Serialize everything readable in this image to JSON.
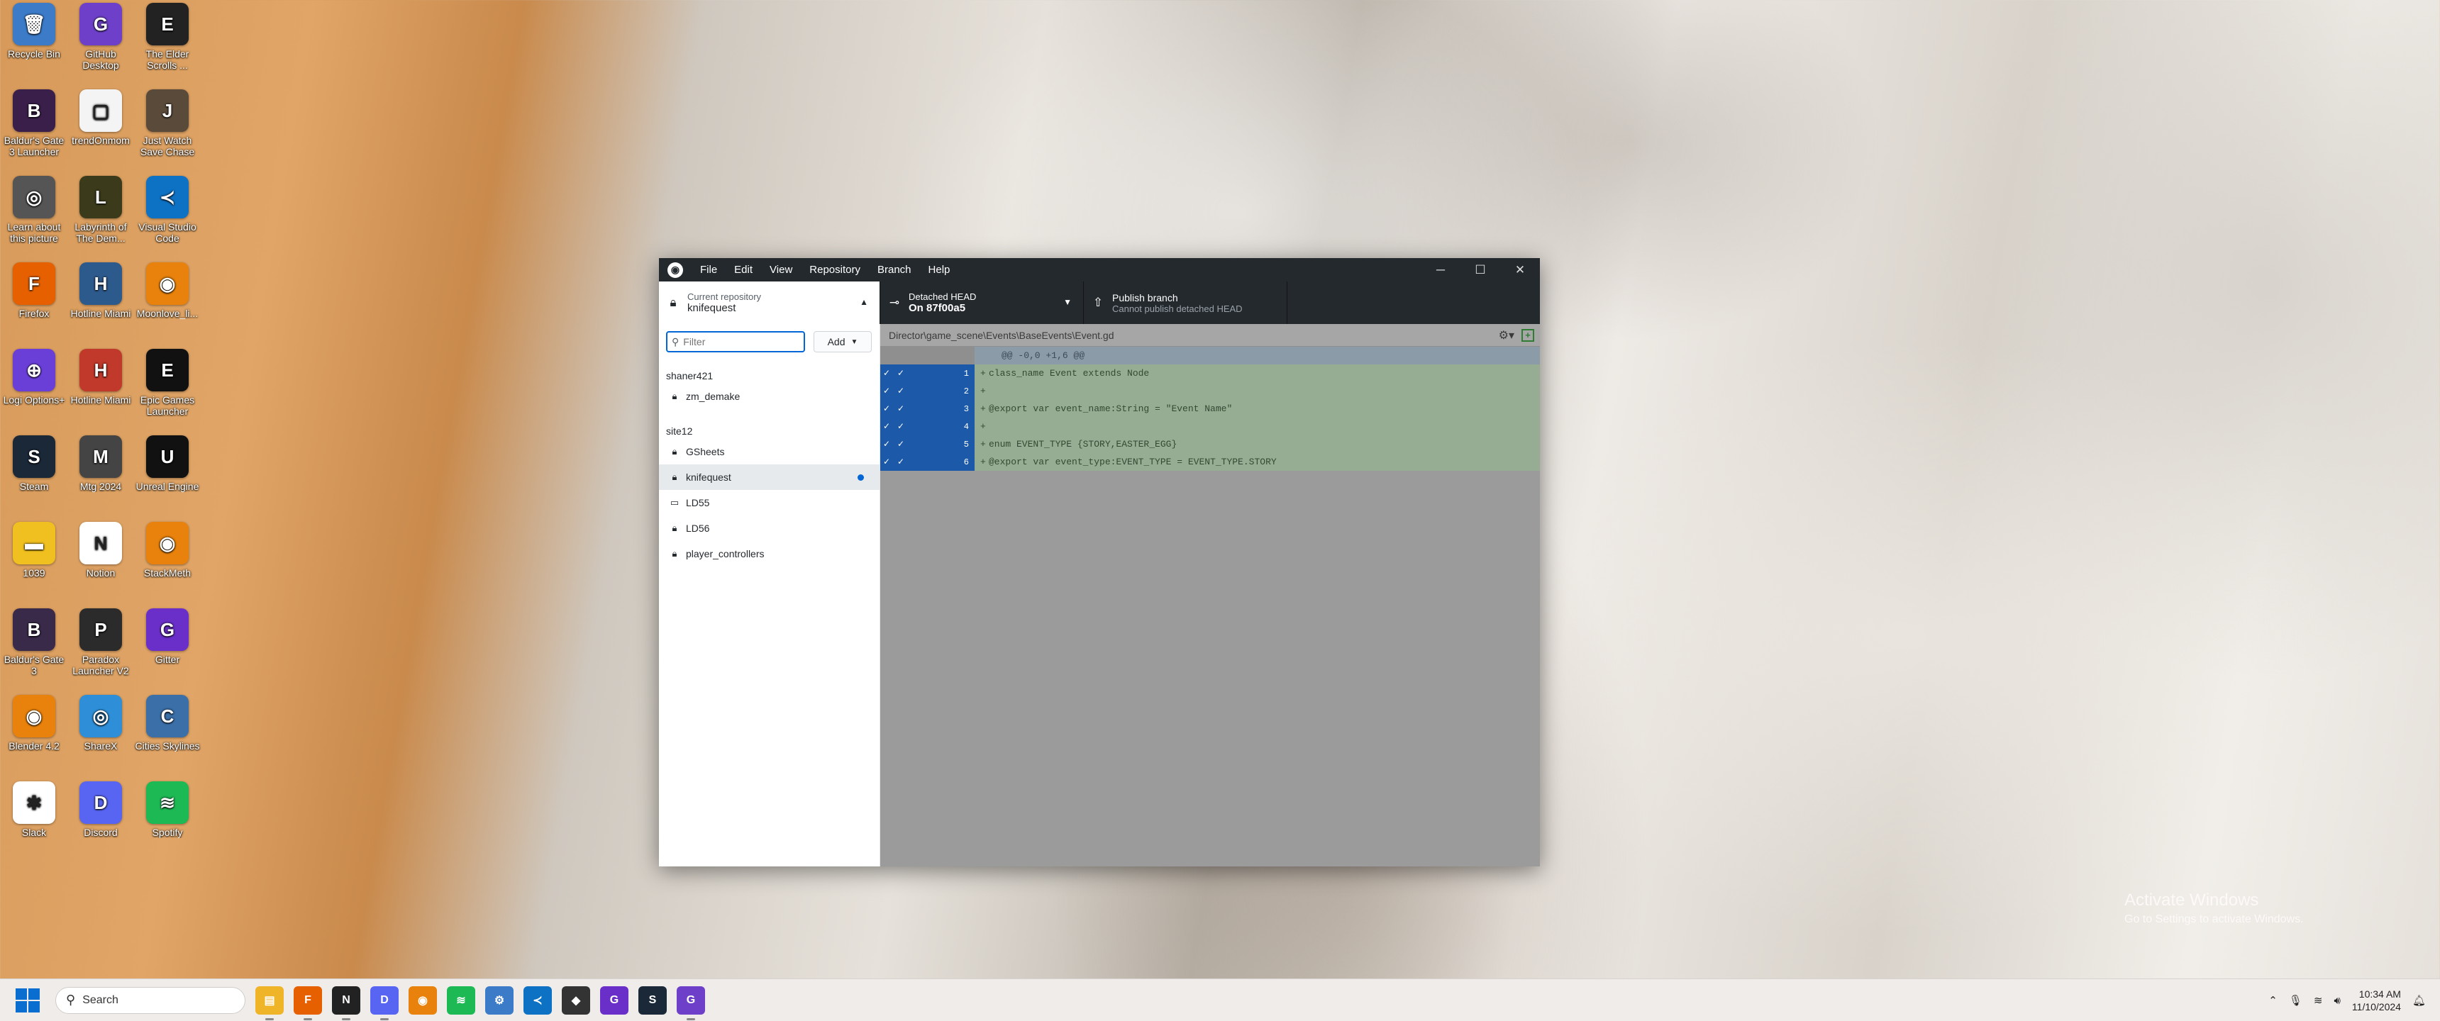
{
  "desktop": {
    "icons": [
      {
        "label": "Recycle Bin",
        "color": "#3b7bc8",
        "glyph": "🗑"
      },
      {
        "label": "GitHub Desktop",
        "color": "#6e40c9",
        "glyph": "G"
      },
      {
        "label": "The Elder Scrolls ...",
        "color": "#222222",
        "glyph": "E"
      },
      {
        "label": "Baldur's Gate 3 Launcher",
        "color": "#3a1f4a",
        "glyph": "B"
      },
      {
        "label": "trendOnmom",
        "color": "#f4f4f4",
        "glyph": "▢"
      },
      {
        "label": "Just Watch Save Chase",
        "color": "#5a4a3a",
        "glyph": "J"
      },
      {
        "label": "Learn about this picture",
        "color": "#555555",
        "glyph": "◎"
      },
      {
        "label": "Labyrinth of The Dem...",
        "color": "#3b3b1b",
        "glyph": "L"
      },
      {
        "label": "Visual Studio Code",
        "color": "#0e72c4",
        "glyph": "≺"
      },
      {
        "label": "Firefox",
        "color": "#e66000",
        "glyph": "F"
      },
      {
        "label": "Hotline Miami",
        "color": "#2d5a8c",
        "glyph": "H"
      },
      {
        "label": "Moonlove_li...",
        "color": "#e8820c",
        "glyph": "◉"
      },
      {
        "label": "Logi Options+",
        "color": "#6a3fd8",
        "glyph": "⊕"
      },
      {
        "label": "Hotline Miami",
        "color": "#c0392b",
        "glyph": "H"
      },
      {
        "label": "Epic Games Launcher",
        "color": "#111111",
        "glyph": "E"
      },
      {
        "label": "Steam",
        "color": "#1b2838",
        "glyph": "S"
      },
      {
        "label": "Mtg 2024",
        "color": "#444444",
        "glyph": "M"
      },
      {
        "label": "Unreal Engine",
        "color": "#111111",
        "glyph": "U"
      },
      {
        "label": "1039",
        "color": "#f0c020",
        "glyph": "▬"
      },
      {
        "label": "Notion",
        "color": "#ffffff",
        "glyph": "N"
      },
      {
        "label": "StackMeth",
        "color": "#e8820c",
        "glyph": "◉"
      },
      {
        "label": "Baldur's Gate 3",
        "color": "#3a2a4a",
        "glyph": "B"
      },
      {
        "label": "Paradox Launcher V2",
        "color": "#2b2b2b",
        "glyph": "P"
      },
      {
        "label": "Gitter",
        "color": "#6a2fc8",
        "glyph": "G"
      },
      {
        "label": "Blender 4.2",
        "color": "#e8820c",
        "glyph": "◉"
      },
      {
        "label": "ShareX",
        "color": "#2e8fd8",
        "glyph": "◎"
      },
      {
        "label": "Cities Skylines",
        "color": "#3a6fa8",
        "glyph": "C"
      },
      {
        "label": "Slack",
        "color": "#ffffff",
        "glyph": "✱"
      },
      {
        "label": "Discord",
        "color": "#5865f2",
        "glyph": "D"
      },
      {
        "label": "Spotify",
        "color": "#1db954",
        "glyph": "≋"
      }
    ]
  },
  "window": {
    "menu": [
      "File",
      "Edit",
      "View",
      "Repository",
      "Branch",
      "Help"
    ],
    "controls": {
      "minimize": "─",
      "maximize": "☐",
      "close": "✕"
    }
  },
  "toolbar": {
    "current_repo_label": "Current repository",
    "current_repo_value": "knifequest",
    "branch_label": "Detached HEAD",
    "branch_value": "On 87f00a5",
    "publish_label": "Publish branch",
    "publish_sub": "Cannot publish detached HEAD"
  },
  "sidebar": {
    "filter_placeholder": "Filter",
    "add_label": "Add",
    "groups": [
      {
        "title": "shaner421",
        "repos": [
          {
            "name": "zm_demake",
            "icon": "monitor-icon"
          }
        ]
      },
      {
        "title": "site12",
        "repos": [
          {
            "name": "GSheets",
            "icon": "lock-icon"
          },
          {
            "name": "knifequest",
            "icon": "lock-icon",
            "selected": true
          },
          {
            "name": "LD55",
            "icon": "monitor-icon"
          },
          {
            "name": "LD56",
            "icon": "lock-icon"
          },
          {
            "name": "player_controllers",
            "icon": "lock-icon"
          }
        ]
      }
    ]
  },
  "diff": {
    "file_path": "Director\\game_scene\\Events\\BaseEvents\\Event.gd",
    "hunk_header": "@@ -0,0 +1,6 @@",
    "lines": [
      {
        "num": "1",
        "text": "class_name Event extends Node"
      },
      {
        "num": "2",
        "text": ""
      },
      {
        "num": "3",
        "text": "@export var event_name:String = \"Event Name\""
      },
      {
        "num": "4",
        "text": ""
      },
      {
        "num": "5",
        "text": "enum EVENT_TYPE {STORY,EASTER_EGG}"
      },
      {
        "num": "6",
        "text": "@export var event_type:EVENT_TYPE = EVENT_TYPE.STORY"
      }
    ]
  },
  "watermark": {
    "title": "Activate Windows",
    "subtitle": "Go to Settings to activate Windows."
  },
  "taskbar": {
    "search_placeholder": "Search",
    "apps": [
      {
        "name": "file-explorer",
        "color": "#f0b429",
        "glyph": "▤"
      },
      {
        "name": "firefox",
        "color": "#e66000",
        "glyph": "F"
      },
      {
        "name": "notion",
        "color": "#222222",
        "glyph": "N"
      },
      {
        "name": "discord",
        "color": "#5865f2",
        "glyph": "D"
      },
      {
        "name": "blender",
        "color": "#e8820c",
        "glyph": "◉"
      },
      {
        "name": "spotify",
        "color": "#1db954",
        "glyph": "≋"
      },
      {
        "name": "settings",
        "color": "#3b7bc8",
        "glyph": "⚙"
      },
      {
        "name": "vscode",
        "color": "#0e72c4",
        "glyph": "≺"
      },
      {
        "name": "game",
        "color": "#333333",
        "glyph": "◆"
      },
      {
        "name": "gitter",
        "color": "#6a2fc8",
        "glyph": "G"
      },
      {
        "name": "steam",
        "color": "#1b2838",
        "glyph": "S"
      },
      {
        "name": "github-desktop",
        "color": "#6e40c9",
        "glyph": "G"
      }
    ],
    "time": "10:34 AM",
    "date": "11/10/2024"
  }
}
